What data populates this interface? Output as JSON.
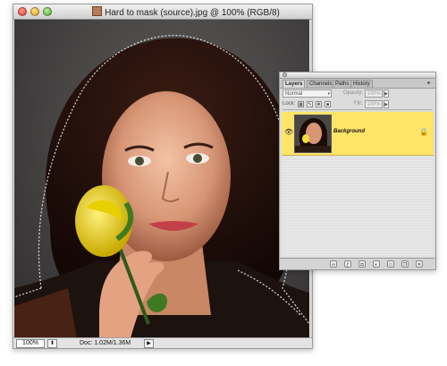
{
  "document": {
    "title": "Hard to mask (source).jpg @ 100% (RGB/8)",
    "zoom": "100%",
    "doc_size": "Doc: 1.02M/1.36M",
    "zoom_menu_glyph": "⬍",
    "status_arrow_glyph": "▶",
    "window_buttons": [
      "close-button",
      "minimize-button",
      "zoom-button"
    ]
  },
  "layers_panel": {
    "tabs": [
      {
        "label": "Layers",
        "active": true
      },
      {
        "label": "Channels",
        "active": false
      },
      {
        "label": "Paths",
        "active": false
      },
      {
        "label": "History",
        "active": false
      }
    ],
    "menu_glyph": "▸",
    "blend_mode": "Normal",
    "opacity_label": "Opacity:",
    "opacity_value": "100%",
    "lock_label": "Lock:",
    "lock_icons": [
      "lock-transparent-icon",
      "lock-image-icon",
      "lock-position-icon",
      "lock-all-icon"
    ],
    "fill_label": "Fill:",
    "fill_value": "100%",
    "layers": [
      {
        "name": "Background",
        "visible": true,
        "locked": true,
        "selected": true
      }
    ],
    "footer_icons": [
      "link-icon",
      "layer-style-icon",
      "layer-mask-icon",
      "adjustment-layer-icon",
      "new-group-icon",
      "new-layer-icon",
      "trash-icon"
    ]
  },
  "colors": {
    "selected_layer": "#ffe46a",
    "panel_background": "#dcdcdc"
  }
}
